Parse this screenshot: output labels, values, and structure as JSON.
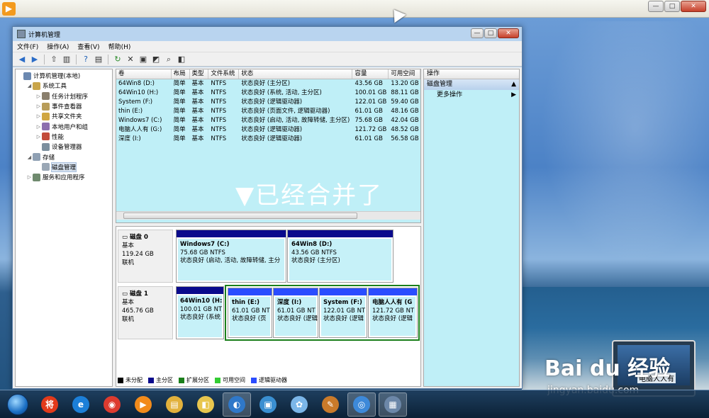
{
  "window": {
    "title": "计算机管理"
  },
  "menu": [
    "文件(F)",
    "操作(A)",
    "查看(V)",
    "帮助(H)"
  ],
  "tree": [
    {
      "label": "计算机管理(本地)",
      "depth": 0,
      "arrow": ""
    },
    {
      "label": "系统工具",
      "depth": 1,
      "arrow": "◢"
    },
    {
      "label": "任务计划程序",
      "depth": 2,
      "arrow": "▷"
    },
    {
      "label": "事件查看器",
      "depth": 2,
      "arrow": "▷"
    },
    {
      "label": "共享文件夹",
      "depth": 2,
      "arrow": "▷"
    },
    {
      "label": "本地用户和组",
      "depth": 2,
      "arrow": "▷"
    },
    {
      "label": "性能",
      "depth": 2,
      "arrow": "▷"
    },
    {
      "label": "设备管理器",
      "depth": 2,
      "arrow": ""
    },
    {
      "label": "存储",
      "depth": 1,
      "arrow": "◢"
    },
    {
      "label": "磁盘管理",
      "depth": 2,
      "arrow": "",
      "selected": true
    },
    {
      "label": "服务和应用程序",
      "depth": 1,
      "arrow": "▷"
    }
  ],
  "volume_table": {
    "headers": [
      "卷",
      "布局",
      "类型",
      "文件系统",
      "状态",
      "容量",
      "可用空间"
    ],
    "rows": [
      [
        "64Win8 (D:)",
        "简单",
        "基本",
        "NTFS",
        "状态良好 (主分区)",
        "43.56 GB",
        "13.20 GB"
      ],
      [
        "64Win10 (H:)",
        "简单",
        "基本",
        "NTFS",
        "状态良好 (系统, 活动, 主分区)",
        "100.01 GB",
        "88.11 GB"
      ],
      [
        "System (F:)",
        "简单",
        "基本",
        "NTFS",
        "状态良好 (逻辑驱动器)",
        "122.01 GB",
        "59.40 GB"
      ],
      [
        "thin (E:)",
        "简单",
        "基本",
        "NTFS",
        "状态良好 (页面文件, 逻辑驱动器)",
        "61.01 GB",
        "48.16 GB"
      ],
      [
        "Windows7 (C:)",
        "简单",
        "基本",
        "NTFS",
        "状态良好 (启动, 活动, 故障转储, 主分区)",
        "75.68 GB",
        "42.04 GB"
      ],
      [
        "电脑人人有 (G:)",
        "简单",
        "基本",
        "NTFS",
        "状态良好 (逻辑驱动器)",
        "121.72 GB",
        "48.52 GB"
      ],
      [
        "深度 (I:)",
        "简单",
        "基本",
        "NTFS",
        "状态良好 (逻辑驱动器)",
        "61.01 GB",
        "56.58 GB"
      ]
    ]
  },
  "overlay_note": "▼已经合并了",
  "disks": [
    {
      "name": "磁盘 0",
      "type": "基本",
      "size": "119.24 GB",
      "status": "联机",
      "partitions": [
        {
          "name": "Windows7  (C:)",
          "size": "75.68 GB NTFS",
          "status": "状态良好 (启动, 活动, 故障转储, 主分"
        },
        {
          "name": "64Win8   (D:)",
          "size": "43.56 GB NTFS",
          "status": "状态良好 (主分区)"
        }
      ]
    },
    {
      "name": "磁盘 1",
      "type": "基本",
      "size": "465.76 GB",
      "status": "联机",
      "partitions": [
        {
          "name": "64Win10  (H:",
          "size": "100.01 GB NT",
          "status": "状态良好 (系统"
        },
        {
          "name": "thin  (E:)",
          "size": "61.01 GB NT",
          "status": "状态良好 (页"
        },
        {
          "name": "深度  (I:)",
          "size": "61.01 GB NT",
          "status": "状态良好 (逻辑"
        },
        {
          "name": "System  (F:)",
          "size": "122.01 GB NT",
          "status": "状态良好 (逻辑"
        },
        {
          "name": "电脑人人有  (G",
          "size": "121.72 GB NT",
          "status": "状态良好 (逻辑"
        }
      ]
    }
  ],
  "legend": [
    {
      "label": "未分配",
      "color": "#000000"
    },
    {
      "label": "主分区",
      "color": "#0a0a8c"
    },
    {
      "label": "扩展分区",
      "color": "#1b7f1b"
    },
    {
      "label": "可用空间",
      "color": "#33cc33"
    },
    {
      "label": "逻辑驱动器",
      "color": "#2a4cff"
    }
  ],
  "actions": {
    "header": "操作",
    "section": "磁盘管理",
    "item": "更多操作"
  },
  "viewer": {
    "logo": "▶"
  },
  "taskbar": {
    "apps": [
      {
        "icon": "jiang-icon",
        "glyph": "将",
        "color": "#e23a1b"
      },
      {
        "icon": "ie-icon",
        "glyph": "e",
        "color": "#1c7fd8"
      },
      {
        "icon": "chrome-icon",
        "glyph": "◉",
        "color": "#dd3b2f"
      },
      {
        "icon": "media-player-icon",
        "glyph": "▶",
        "color": "#f28b1b"
      },
      {
        "icon": "explorer-icon",
        "glyph": "▤",
        "color": "#e2b13c"
      },
      {
        "icon": "folder-icon",
        "glyph": "◧",
        "color": "#e8c64e"
      },
      {
        "icon": "browser-icon",
        "glyph": "◐",
        "color": "#2f78c9",
        "active": true
      },
      {
        "icon": "remote-icon",
        "glyph": "▣",
        "color": "#3a8fd1"
      },
      {
        "icon": "tool-icon",
        "glyph": "✿",
        "color": "#7bb6e8"
      },
      {
        "icon": "paint-icon",
        "glyph": "✎",
        "color": "#c97a2a"
      },
      {
        "icon": "network-icon",
        "glyph": "◎",
        "color": "#3d89d9",
        "active": true
      },
      {
        "icon": "computer-management-icon",
        "glyph": "▦",
        "color": "#6c87a8",
        "active": true
      }
    ]
  },
  "watermark": {
    "brand": "Bai du 经验",
    "url": "jingyan.baidu.com",
    "laptop_text": "电脑人人有"
  },
  "colors": {
    "primary_partition": "#0a0a8c",
    "extended_partition": "#1b7f1b",
    "volume_bg": "#bfeff7"
  }
}
